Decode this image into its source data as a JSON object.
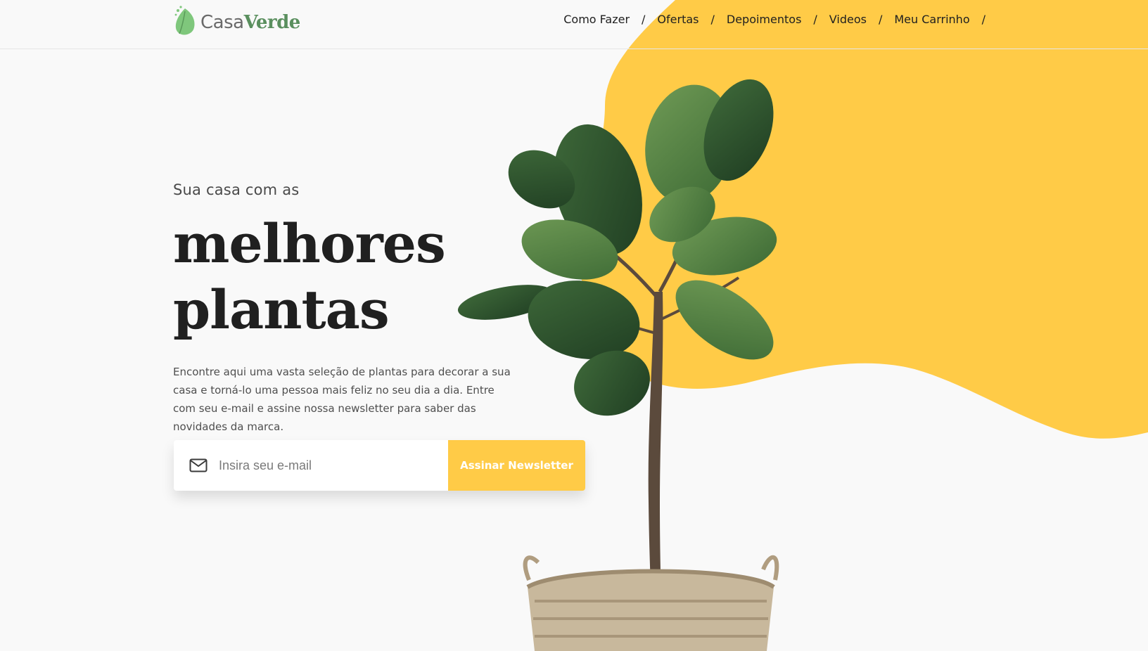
{
  "brand": {
    "name_light": "Casa",
    "name_bold": "Verde",
    "icon": "leaf-icon",
    "accent": "#ffcb47",
    "green": "#5a8f5e"
  },
  "nav": {
    "items": [
      {
        "label": "Como Fazer"
      },
      {
        "label": "Ofertas"
      },
      {
        "label": "Depoimentos"
      },
      {
        "label": "Videos"
      },
      {
        "label": "Meu Carrinho"
      }
    ],
    "separator": "/"
  },
  "hero": {
    "kicker": "Sua casa com as",
    "headline_line1": "melhores",
    "headline_line2": "plantas",
    "description": "Encontre aqui uma vasta seleção de plantas para decorar a sua casa e torná-lo uma pessoa mais feliz no seu dia a dia. Entre com seu e-mail e assine nossa newsletter para saber das novidades da marca."
  },
  "newsletter": {
    "placeholder": "Insira seu e-mail",
    "value": "",
    "button_label": "Assinar Newsletter",
    "icon": "mail-icon"
  }
}
